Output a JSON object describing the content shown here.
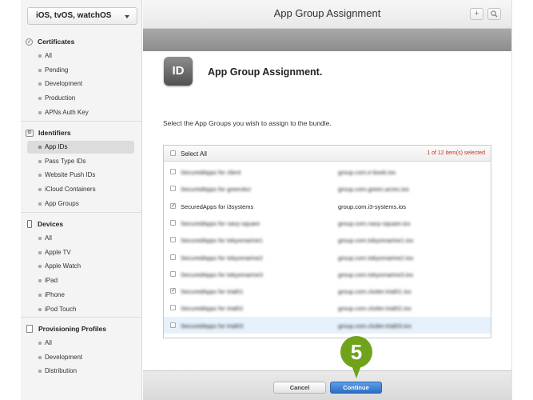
{
  "sidebar": {
    "platform": "iOS, tvOS, watchOS",
    "sections": [
      {
        "title": "Certificates",
        "items": [
          "All",
          "Pending",
          "Development",
          "Production",
          "APNs Auth Key"
        ]
      },
      {
        "title": "Identifiers",
        "items": [
          "App IDs",
          "Pass Type IDs",
          "Website Push IDs",
          "iCloud Containers",
          "App Groups"
        ]
      },
      {
        "title": "Devices",
        "items": [
          "All",
          "Apple TV",
          "Apple Watch",
          "iPad",
          "iPhone",
          "iPod Touch"
        ]
      },
      {
        "title": "Provisioning Profiles",
        "items": [
          "All",
          "Development",
          "Distribution"
        ]
      }
    ]
  },
  "header": {
    "title": "App Group Assignment",
    "add_icon": "plus-icon",
    "search_icon": "search-icon"
  },
  "content": {
    "icon_text": "ID",
    "title": "App Group Assignment.",
    "instructions": "Select the App Groups you wish to assign to the bundle.",
    "select_all": "Select All",
    "selected_count": "1 of 12 item(s) selected",
    "rows": [
      {
        "name": "SecuredApps for client",
        "group": "group.com.e-book.ios",
        "checked": false,
        "blurred": true
      },
      {
        "name": "SecuredApps for greenAcr",
        "group": "group.com.green.acres.ios",
        "checked": false,
        "blurred": true
      },
      {
        "name": "SecuredApps for i3systems",
        "group": "group.com.i3-systems.ios",
        "checked": true,
        "blurred": false
      },
      {
        "name": "SecuredApps for navy-square",
        "group": "group.com.navy-square.ios",
        "checked": false,
        "blurred": true
      },
      {
        "name": "SecuredApps for tokyomarine1",
        "group": "group.com.tokyomarine1.ios",
        "checked": false,
        "blurred": true
      },
      {
        "name": "SecuredApps for tokyomarine2",
        "group": "group.com.tokyomarine2.ios",
        "checked": false,
        "blurred": true
      },
      {
        "name": "SecuredApps for tokyomarine3",
        "group": "group.com.tokyomarine3.ios",
        "checked": false,
        "blurred": true
      },
      {
        "name": "SecuredApps for trial01",
        "group": "group.com.clutter.trial01.ios",
        "checked": true,
        "blurred": true
      },
      {
        "name": "SecuredApps for trial02",
        "group": "group.com.clutter.trial02.ios",
        "checked": false,
        "blurred": true
      },
      {
        "name": "SecuredApps for trial03",
        "group": "group.com.clutter.trial03.ios",
        "checked": false,
        "blurred": true
      }
    ]
  },
  "footer": {
    "cancel": "Cancel",
    "continue": "Continue"
  },
  "callout": {
    "step": "5",
    "color": "#6fa31c"
  },
  "colors": {
    "accent_blue": "#2c6fc6",
    "count_red": "#d12b1f",
    "row_highlight": "#e6f1fb"
  }
}
